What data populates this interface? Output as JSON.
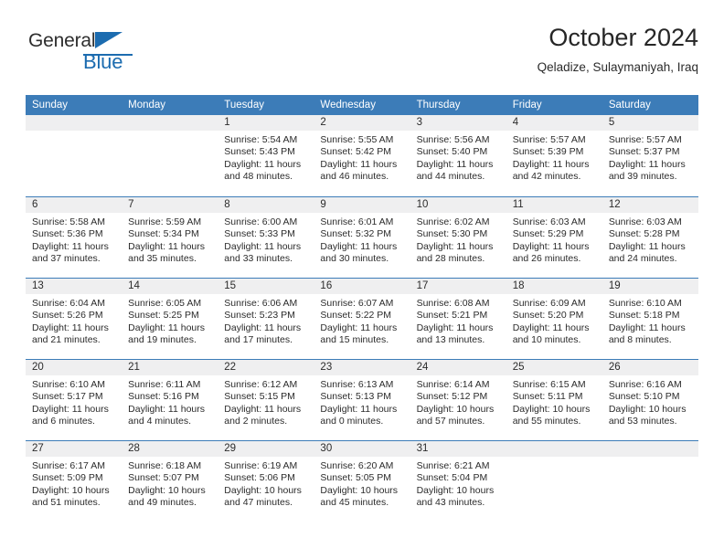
{
  "brand": {
    "line1": "General",
    "line2": "Blue",
    "triangle_icon": "blue-triangle-icon",
    "color_dark": "#2e2e2e",
    "color_blue": "#1c6cb0"
  },
  "header": {
    "title": "October 2024",
    "subtitle": "Qeladize, Sulaymaniyah, Iraq"
  },
  "theme": {
    "header_blue": "#3c7cb8",
    "cell_head_gray": "#efeff0",
    "text": "#2b2b2b"
  },
  "calendar": {
    "weekday_headers": [
      "Sunday",
      "Monday",
      "Tuesday",
      "Wednesday",
      "Thursday",
      "Friday",
      "Saturday"
    ],
    "weeks": [
      [
        {
          "day": "",
          "sunrise": "",
          "sunset": "",
          "daylight_line1": "",
          "daylight_line2": ""
        },
        {
          "day": "",
          "sunrise": "",
          "sunset": "",
          "daylight_line1": "",
          "daylight_line2": ""
        },
        {
          "day": "1",
          "sunrise": "Sunrise: 5:54 AM",
          "sunset": "Sunset: 5:43 PM",
          "daylight_line1": "Daylight: 11 hours",
          "daylight_line2": "and 48 minutes."
        },
        {
          "day": "2",
          "sunrise": "Sunrise: 5:55 AM",
          "sunset": "Sunset: 5:42 PM",
          "daylight_line1": "Daylight: 11 hours",
          "daylight_line2": "and 46 minutes."
        },
        {
          "day": "3",
          "sunrise": "Sunrise: 5:56 AM",
          "sunset": "Sunset: 5:40 PM",
          "daylight_line1": "Daylight: 11 hours",
          "daylight_line2": "and 44 minutes."
        },
        {
          "day": "4",
          "sunrise": "Sunrise: 5:57 AM",
          "sunset": "Sunset: 5:39 PM",
          "daylight_line1": "Daylight: 11 hours",
          "daylight_line2": "and 42 minutes."
        },
        {
          "day": "5",
          "sunrise": "Sunrise: 5:57 AM",
          "sunset": "Sunset: 5:37 PM",
          "daylight_line1": "Daylight: 11 hours",
          "daylight_line2": "and 39 minutes."
        }
      ],
      [
        {
          "day": "6",
          "sunrise": "Sunrise: 5:58 AM",
          "sunset": "Sunset: 5:36 PM",
          "daylight_line1": "Daylight: 11 hours",
          "daylight_line2": "and 37 minutes."
        },
        {
          "day": "7",
          "sunrise": "Sunrise: 5:59 AM",
          "sunset": "Sunset: 5:34 PM",
          "daylight_line1": "Daylight: 11 hours",
          "daylight_line2": "and 35 minutes."
        },
        {
          "day": "8",
          "sunrise": "Sunrise: 6:00 AM",
          "sunset": "Sunset: 5:33 PM",
          "daylight_line1": "Daylight: 11 hours",
          "daylight_line2": "and 33 minutes."
        },
        {
          "day": "9",
          "sunrise": "Sunrise: 6:01 AM",
          "sunset": "Sunset: 5:32 PM",
          "daylight_line1": "Daylight: 11 hours",
          "daylight_line2": "and 30 minutes."
        },
        {
          "day": "10",
          "sunrise": "Sunrise: 6:02 AM",
          "sunset": "Sunset: 5:30 PM",
          "daylight_line1": "Daylight: 11 hours",
          "daylight_line2": "and 28 minutes."
        },
        {
          "day": "11",
          "sunrise": "Sunrise: 6:03 AM",
          "sunset": "Sunset: 5:29 PM",
          "daylight_line1": "Daylight: 11 hours",
          "daylight_line2": "and 26 minutes."
        },
        {
          "day": "12",
          "sunrise": "Sunrise: 6:03 AM",
          "sunset": "Sunset: 5:28 PM",
          "daylight_line1": "Daylight: 11 hours",
          "daylight_line2": "and 24 minutes."
        }
      ],
      [
        {
          "day": "13",
          "sunrise": "Sunrise: 6:04 AM",
          "sunset": "Sunset: 5:26 PM",
          "daylight_line1": "Daylight: 11 hours",
          "daylight_line2": "and 21 minutes."
        },
        {
          "day": "14",
          "sunrise": "Sunrise: 6:05 AM",
          "sunset": "Sunset: 5:25 PM",
          "daylight_line1": "Daylight: 11 hours",
          "daylight_line2": "and 19 minutes."
        },
        {
          "day": "15",
          "sunrise": "Sunrise: 6:06 AM",
          "sunset": "Sunset: 5:23 PM",
          "daylight_line1": "Daylight: 11 hours",
          "daylight_line2": "and 17 minutes."
        },
        {
          "day": "16",
          "sunrise": "Sunrise: 6:07 AM",
          "sunset": "Sunset: 5:22 PM",
          "daylight_line1": "Daylight: 11 hours",
          "daylight_line2": "and 15 minutes."
        },
        {
          "day": "17",
          "sunrise": "Sunrise: 6:08 AM",
          "sunset": "Sunset: 5:21 PM",
          "daylight_line1": "Daylight: 11 hours",
          "daylight_line2": "and 13 minutes."
        },
        {
          "day": "18",
          "sunrise": "Sunrise: 6:09 AM",
          "sunset": "Sunset: 5:20 PM",
          "daylight_line1": "Daylight: 11 hours",
          "daylight_line2": "and 10 minutes."
        },
        {
          "day": "19",
          "sunrise": "Sunrise: 6:10 AM",
          "sunset": "Sunset: 5:18 PM",
          "daylight_line1": "Daylight: 11 hours",
          "daylight_line2": "and 8 minutes."
        }
      ],
      [
        {
          "day": "20",
          "sunrise": "Sunrise: 6:10 AM",
          "sunset": "Sunset: 5:17 PM",
          "daylight_line1": "Daylight: 11 hours",
          "daylight_line2": "and 6 minutes."
        },
        {
          "day": "21",
          "sunrise": "Sunrise: 6:11 AM",
          "sunset": "Sunset: 5:16 PM",
          "daylight_line1": "Daylight: 11 hours",
          "daylight_line2": "and 4 minutes."
        },
        {
          "day": "22",
          "sunrise": "Sunrise: 6:12 AM",
          "sunset": "Sunset: 5:15 PM",
          "daylight_line1": "Daylight: 11 hours",
          "daylight_line2": "and 2 minutes."
        },
        {
          "day": "23",
          "sunrise": "Sunrise: 6:13 AM",
          "sunset": "Sunset: 5:13 PM",
          "daylight_line1": "Daylight: 11 hours",
          "daylight_line2": "and 0 minutes."
        },
        {
          "day": "24",
          "sunrise": "Sunrise: 6:14 AM",
          "sunset": "Sunset: 5:12 PM",
          "daylight_line1": "Daylight: 10 hours",
          "daylight_line2": "and 57 minutes."
        },
        {
          "day": "25",
          "sunrise": "Sunrise: 6:15 AM",
          "sunset": "Sunset: 5:11 PM",
          "daylight_line1": "Daylight: 10 hours",
          "daylight_line2": "and 55 minutes."
        },
        {
          "day": "26",
          "sunrise": "Sunrise: 6:16 AM",
          "sunset": "Sunset: 5:10 PM",
          "daylight_line1": "Daylight: 10 hours",
          "daylight_line2": "and 53 minutes."
        }
      ],
      [
        {
          "day": "27",
          "sunrise": "Sunrise: 6:17 AM",
          "sunset": "Sunset: 5:09 PM",
          "daylight_line1": "Daylight: 10 hours",
          "daylight_line2": "and 51 minutes."
        },
        {
          "day": "28",
          "sunrise": "Sunrise: 6:18 AM",
          "sunset": "Sunset: 5:07 PM",
          "daylight_line1": "Daylight: 10 hours",
          "daylight_line2": "and 49 minutes."
        },
        {
          "day": "29",
          "sunrise": "Sunrise: 6:19 AM",
          "sunset": "Sunset: 5:06 PM",
          "daylight_line1": "Daylight: 10 hours",
          "daylight_line2": "and 47 minutes."
        },
        {
          "day": "30",
          "sunrise": "Sunrise: 6:20 AM",
          "sunset": "Sunset: 5:05 PM",
          "daylight_line1": "Daylight: 10 hours",
          "daylight_line2": "and 45 minutes."
        },
        {
          "day": "31",
          "sunrise": "Sunrise: 6:21 AM",
          "sunset": "Sunset: 5:04 PM",
          "daylight_line1": "Daylight: 10 hours",
          "daylight_line2": "and 43 minutes."
        },
        {
          "day": "",
          "sunrise": "",
          "sunset": "",
          "daylight_line1": "",
          "daylight_line2": ""
        },
        {
          "day": "",
          "sunrise": "",
          "sunset": "",
          "daylight_line1": "",
          "daylight_line2": ""
        }
      ]
    ]
  }
}
